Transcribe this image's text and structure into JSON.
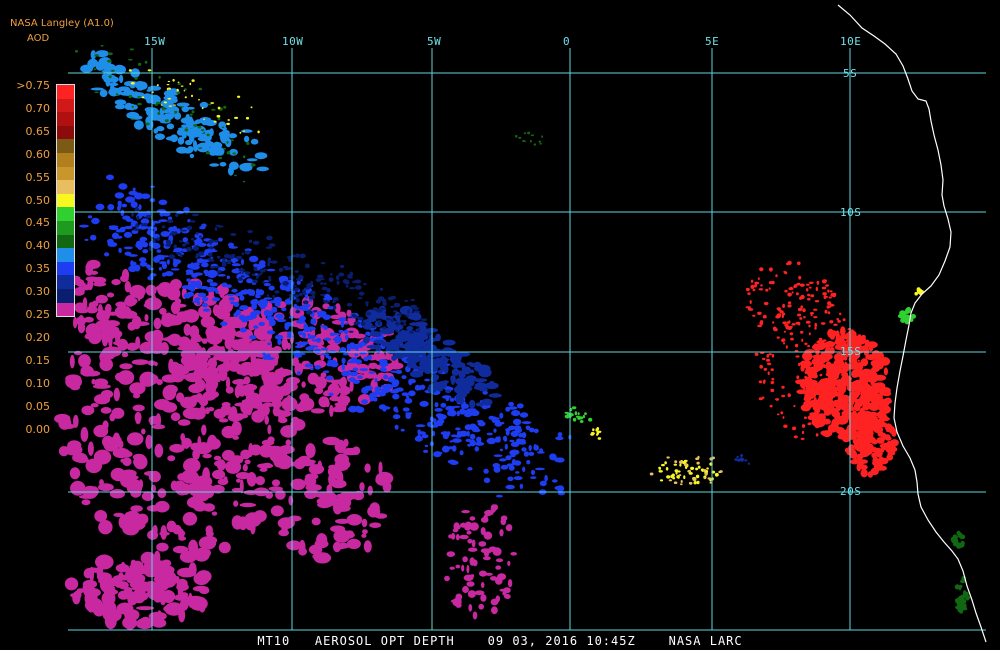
{
  "header": {
    "source": "NASA Langley (A1.0)",
    "product": "AOD"
  },
  "legend": {
    "labels": [
      ">0.75",
      "0.70",
      "0.65",
      "0.60",
      "0.55",
      "0.50",
      "0.45",
      "0.40",
      "0.35",
      "0.30",
      "0.25",
      "0.20",
      "0.15",
      "0.10",
      "0.05",
      "0.00"
    ],
    "colors": [
      "#ff2222",
      "#d01a1a",
      "#b01010",
      "#8c0c0c",
      "#7a5a14",
      "#b27f1e",
      "#c8962a",
      "#e8be60",
      "#f8f820",
      "#30d030",
      "#1e9a1e",
      "#126812",
      "#1e8ee8",
      "#1e3cf0",
      "#102c9c",
      "#0a1e70",
      "#c828a0"
    ]
  },
  "longitude_labels": [
    "15W",
    "10W",
    "5W",
    "0",
    "5E",
    "10E"
  ],
  "latitude_labels": [
    "5S",
    "10S",
    "15S",
    "20S"
  ],
  "footer": "MT10   AEROSOL OPT DEPTH    09 03, 2016 10:45Z    NASA LARC",
  "map": {
    "gridline_color": "#5fd6de",
    "coastline_color": "#ffffff",
    "features": [
      {
        "name": "dust-plume-nw",
        "aod_class": "0.15-0.25"
      },
      {
        "name": "low-aod-marine-sw",
        "aod_class": "0.00-0.05"
      },
      {
        "name": "smoke-plume-angola-coast",
        "aod_class": ">0.75"
      },
      {
        "name": "green-patches-namibia-coast",
        "aod_class": "0.30-0.40"
      },
      {
        "name": "yellow-patches-central",
        "aod_class": "0.40-0.45"
      }
    ]
  }
}
